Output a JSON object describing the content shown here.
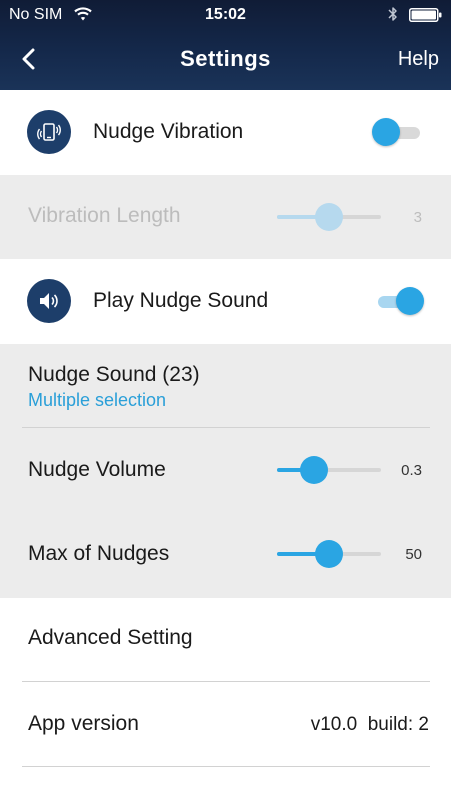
{
  "status_bar": {
    "carrier": "No SIM",
    "time": "15:02"
  },
  "nav": {
    "title": "Settings",
    "help": "Help"
  },
  "settings": {
    "nudge_vibration": {
      "label": "Nudge Vibration",
      "enabled": false
    },
    "vibration_length": {
      "label": "Vibration Length",
      "value": "3",
      "fraction": 0.5,
      "disabled": true
    },
    "play_nudge_sound": {
      "label": "Play Nudge Sound",
      "enabled": true
    },
    "nudge_sound": {
      "label": "Nudge Sound (23)",
      "sublabel": "Multiple selection"
    },
    "nudge_volume": {
      "label": "Nudge Volume",
      "value": "0.3",
      "fraction": 0.36
    },
    "max_of_nudges": {
      "label": "Max of Nudges",
      "value": "50",
      "fraction": 0.5
    },
    "advanced_setting": {
      "label": "Advanced Setting"
    },
    "app_version": {
      "label": "App version",
      "value": "v10.0  build: 2"
    }
  },
  "colors": {
    "accent": "#2aa5e3",
    "accent_light": "#a8d6f0",
    "navy": "#14284a",
    "icon_bg": "#1d3e6a",
    "section_gray": "#ececec"
  },
  "icons": [
    "back-chevron-icon",
    "wifi-icon",
    "bluetooth-icon",
    "battery-icon",
    "phone-vibrate-icon",
    "speaker-icon"
  ]
}
